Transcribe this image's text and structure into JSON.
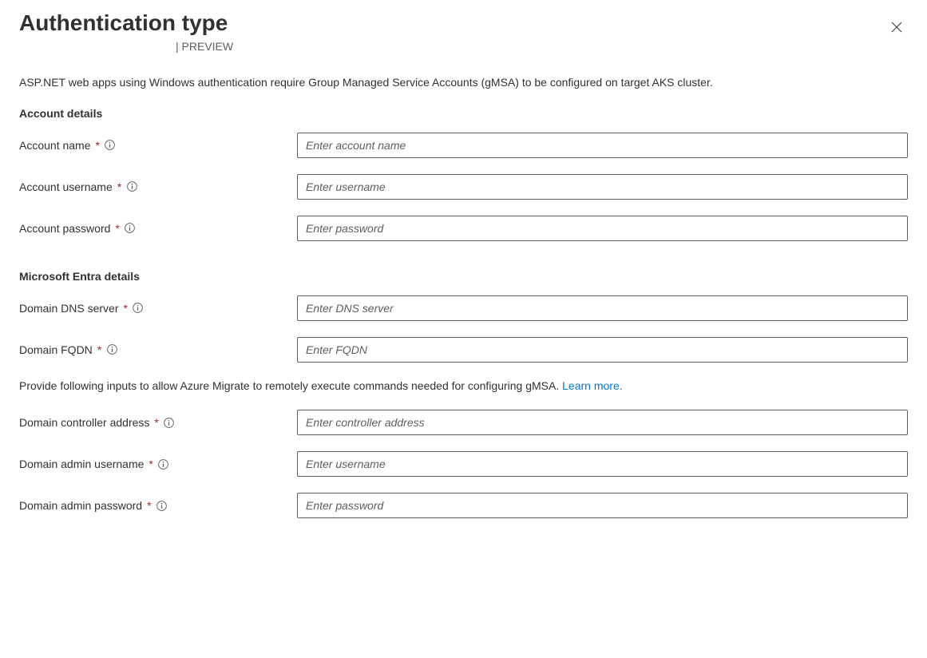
{
  "header": {
    "title": "Authentication type",
    "preview_label": "PREVIEW"
  },
  "description": "ASP.NET web apps using Windows authentication require Group Managed Service Accounts (gMSA) to be configured on target AKS cluster.",
  "sections": {
    "account": {
      "heading": "Account details",
      "fields": {
        "name": {
          "label": "Account name",
          "placeholder": "Enter account name"
        },
        "username": {
          "label": "Account username",
          "placeholder": "Enter username"
        },
        "password": {
          "label": "Account password",
          "placeholder": "Enter password"
        }
      }
    },
    "entra": {
      "heading": "Microsoft Entra details",
      "fields": {
        "dns_server": {
          "label": "Domain DNS server",
          "placeholder": "Enter DNS server"
        },
        "fqdn": {
          "label": "Domain FQDN",
          "placeholder": "Enter FQDN"
        },
        "controller_address": {
          "label": "Domain controller address",
          "placeholder": "Enter controller address"
        },
        "admin_username": {
          "label": "Domain admin username",
          "placeholder": "Enter username"
        },
        "admin_password": {
          "label": "Domain admin password",
          "placeholder": "Enter password"
        }
      },
      "help_text": "Provide following inputs to allow Azure Migrate to remotely execute commands needed for configuring gMSA. ",
      "learn_more": "Learn more."
    }
  }
}
